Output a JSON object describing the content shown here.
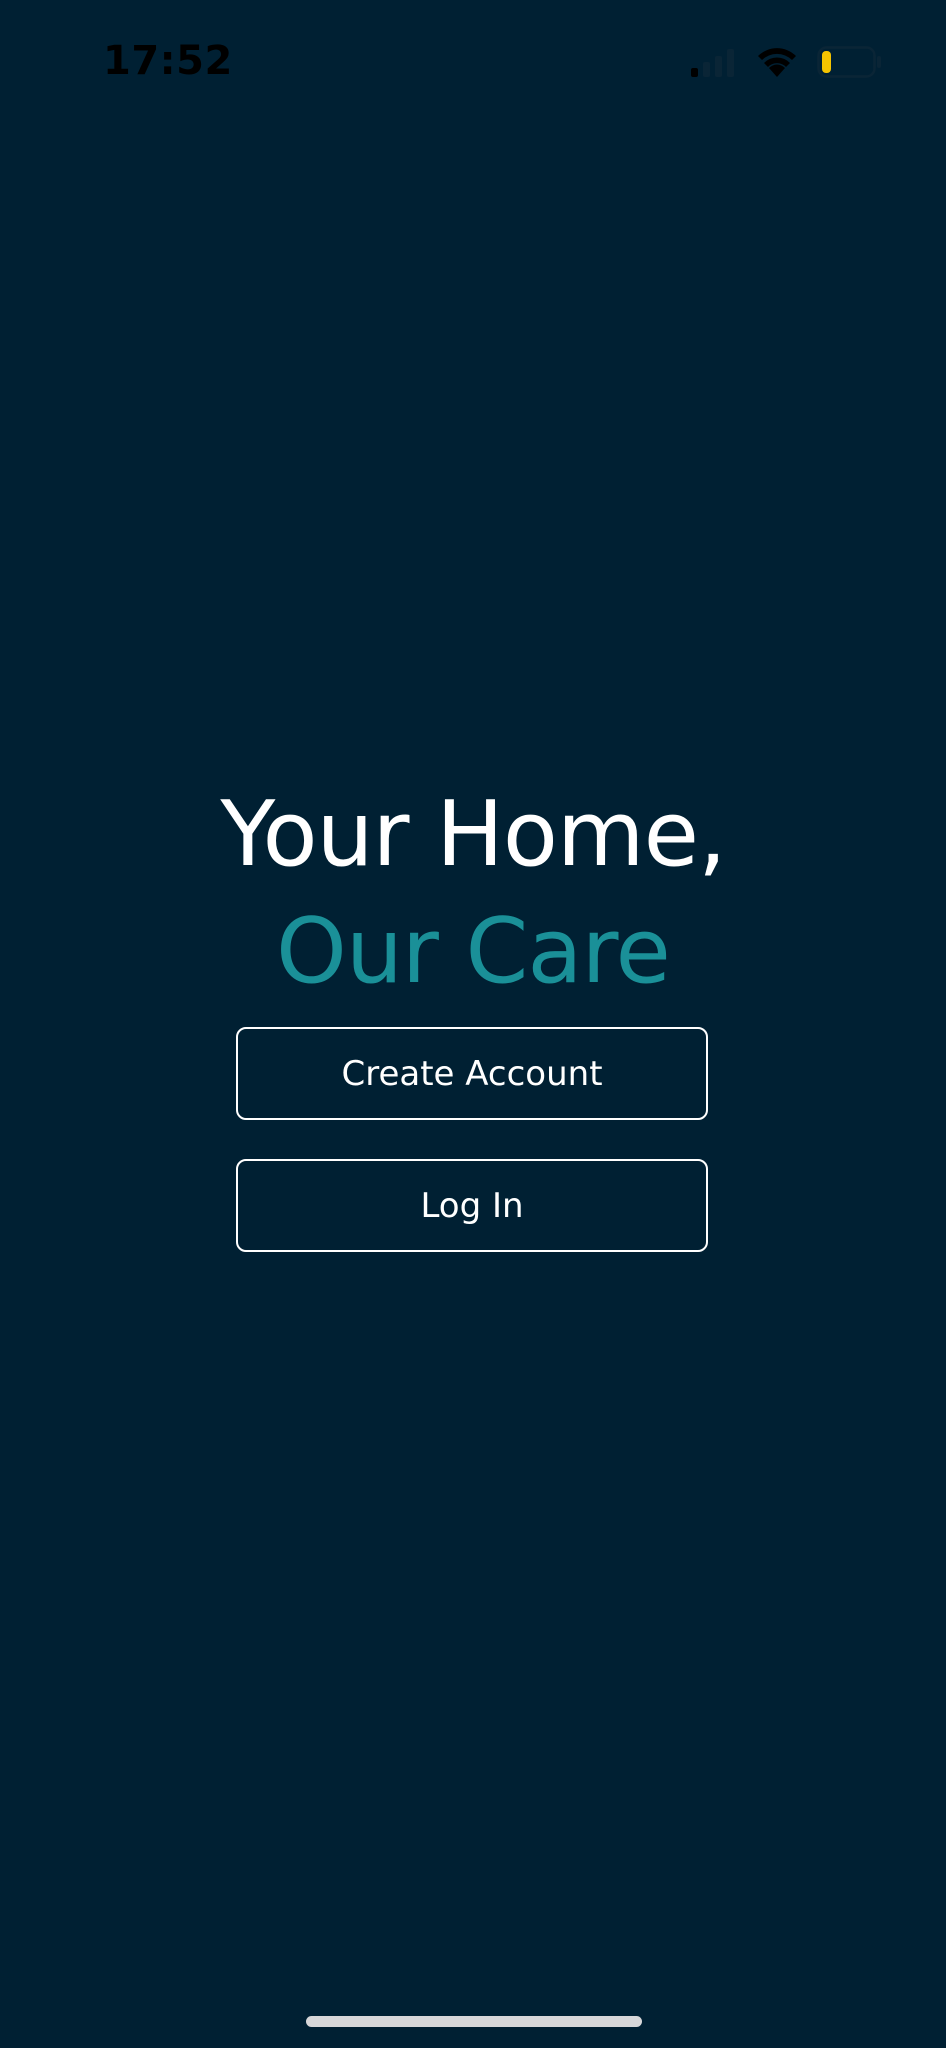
{
  "status_bar": {
    "time": "17:52",
    "signal_icon": "cellular-signal-icon",
    "wifi_icon": "wifi-icon",
    "battery_icon": "battery-low-icon",
    "battery_level": 0.12
  },
  "hero": {
    "line1": "Your Home,",
    "line2": "Our Care"
  },
  "actions": {
    "create_account_label": "Create Account",
    "login_label": "Log In"
  },
  "colors": {
    "background": "#002033",
    "accent": "#1a9098",
    "text": "#ffffff",
    "battery_fill": "#f5c400"
  }
}
